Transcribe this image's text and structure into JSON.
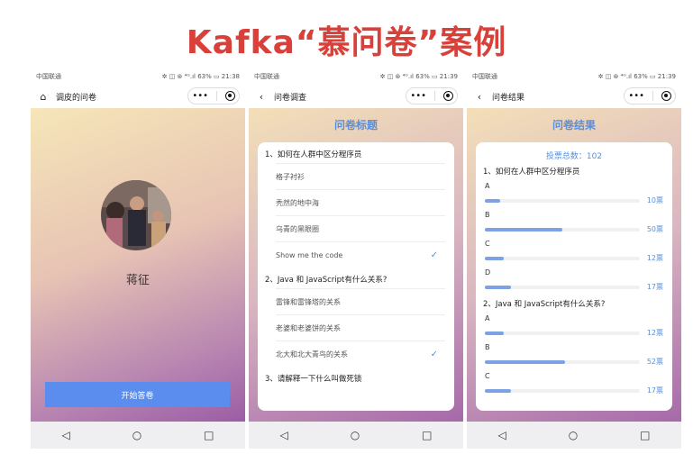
{
  "page_title": "Kafka“慕问卷”案例",
  "phones": [
    {
      "status": {
        "carrier": "中国联通",
        "right": "✲ ◫ ⊛ ⁴ᴳ.ıl 63% ▭ 21:38"
      },
      "nav_title": "调皮的问卷",
      "nav_icon": "home-icon",
      "person_name": "蒋征",
      "start_button": "开始答卷"
    },
    {
      "status": {
        "carrier": "中国联通",
        "right": "✲ ◫ ⊛ ⁴ᴳ.ıl 63% ▭ 21:39"
      },
      "nav_title": "问卷调查",
      "nav_icon": "back-arrow-icon",
      "heading": "问卷标题",
      "questions": [
        {
          "title": "1、如何在人群中区分程序员",
          "options": [
            {
              "label": "格子衬衫",
              "checked": false
            },
            {
              "label": "秃然的地中海",
              "checked": false
            },
            {
              "label": "乌青的黑眼圈",
              "checked": false
            },
            {
              "label": "Show me the code",
              "checked": true
            }
          ]
        },
        {
          "title": "2、Java 和 JavaScript有什么关系?",
          "options": [
            {
              "label": "雷锋和雷锋塔的关系",
              "checked": false
            },
            {
              "label": "老婆和老婆饼的关系",
              "checked": false
            },
            {
              "label": "北大和北大青鸟的关系",
              "checked": true
            }
          ]
        },
        {
          "title": "3、请解释一下什么叫做死锁",
          "options": []
        }
      ]
    },
    {
      "status": {
        "carrier": "中国联通",
        "right": "✲ ◫ ⊛ ⁴ᴳ.ıl 63% ▭ 21:39"
      },
      "nav_title": "问卷结果",
      "nav_icon": "back-arrow-icon",
      "heading": "问卷结果",
      "total": "投票总数：102",
      "results": [
        {
          "title": "1、如何在人群中区分程序员",
          "rows": [
            {
              "label": "A",
              "votes": "10票",
              "fraction": 0.1
            },
            {
              "label": "B",
              "votes": "50票",
              "fraction": 0.5
            },
            {
              "label": "C",
              "votes": "12票",
              "fraction": 0.12
            },
            {
              "label": "D",
              "votes": "17票",
              "fraction": 0.17
            }
          ]
        },
        {
          "title": "2、Java 和 JavaScript有什么关系?",
          "rows": [
            {
              "label": "A",
              "votes": "12票",
              "fraction": 0.12
            },
            {
              "label": "B",
              "votes": "52票",
              "fraction": 0.52
            },
            {
              "label": "C",
              "votes": "17票",
              "fraction": 0.17
            }
          ]
        }
      ]
    }
  ],
  "capsule": {
    "more": "•••",
    "close_icon": "target-icon"
  },
  "bottom_nav": {
    "back": "◁",
    "home": "○",
    "recent": "□"
  },
  "colors": {
    "title_red": "#d9403a",
    "accent_blue": "#5b8def"
  }
}
